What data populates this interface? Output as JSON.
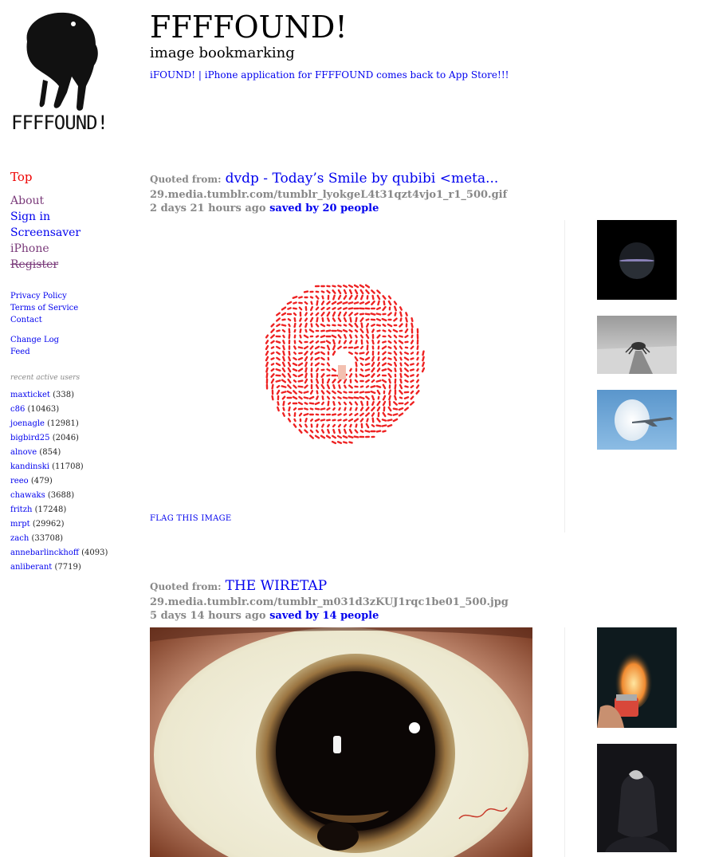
{
  "header": {
    "logo_text": "FFFFOUND!",
    "title": "FFFFOUND!",
    "tagline": "image bookmarking",
    "announcement": "iFOUND! | iPhone application for FFFFOUND comes back to App Store!!!"
  },
  "sidebar": {
    "top": "Top",
    "nav": [
      {
        "label": "About"
      },
      {
        "label": "Sign in"
      },
      {
        "label": "Screensaver"
      },
      {
        "label": "iPhone"
      },
      {
        "label": "Register"
      }
    ],
    "legal": [
      "Privacy Policy",
      "Terms of Service",
      "Contact"
    ],
    "misc": [
      "Change Log",
      "Feed"
    ],
    "recent_title": "recent active users",
    "users": [
      {
        "name": "maxticket",
        "count": "(338)"
      },
      {
        "name": "c86",
        "count": "(10463)"
      },
      {
        "name": "joenagle",
        "count": "(12981)"
      },
      {
        "name": "bigbird25",
        "count": "(2046)"
      },
      {
        "name": "alnove",
        "count": "(854)"
      },
      {
        "name": "kandinski",
        "count": "(11708)"
      },
      {
        "name": "reeo",
        "count": "(479)"
      },
      {
        "name": "chawaks",
        "count": "(3688)"
      },
      {
        "name": "fritzh",
        "count": "(17248)"
      },
      {
        "name": "mrpt",
        "count": "(29962)"
      },
      {
        "name": "zach",
        "count": "(33708)"
      },
      {
        "name": "annebarlinckhoff",
        "count": "(4093)"
      },
      {
        "name": "anliberant",
        "count": "(7719)"
      }
    ]
  },
  "posts": [
    {
      "quoted_label": "Quoted from:",
      "source_title": "dvdp - Today’s Smile by qubibi <meta...",
      "url": "29.media.tumblr.com/tumblr_lyokgeL4t31qzt4vjo1_r1_500.gif",
      "time": "2 days 21 hours ago",
      "saved": "saved by 20 people",
      "flag": "FLAG THIS IMAGE"
    },
    {
      "quoted_label": "Quoted from:",
      "source_title": "THE WIRETAP",
      "url": "29.media.tumblr.com/tumblr_m031d3zKUJ1rqc1be01_500.jpg",
      "time": "5 days 14 hours ago",
      "saved": "saved by 14 people"
    }
  ],
  "colors": {
    "link": "#0000ee",
    "active_nav": "#ee0000",
    "meta_gray": "#888888",
    "dot_red": "#ee2222"
  }
}
